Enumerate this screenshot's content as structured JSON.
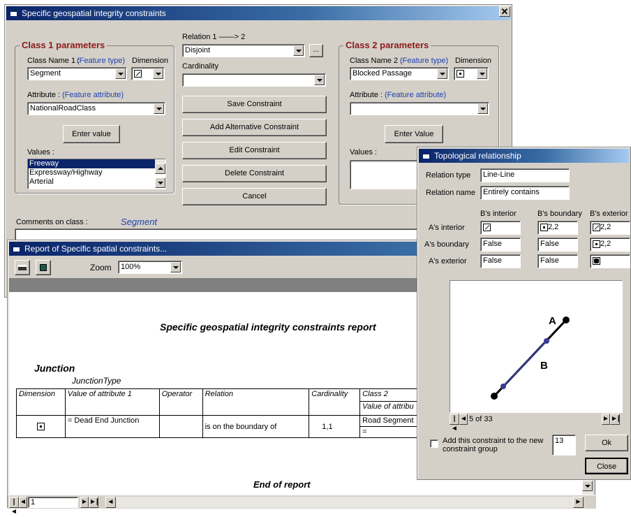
{
  "main_window": {
    "title": "Specific geospatial integrity constraints",
    "class1": {
      "group_title": "Class 1 parameters",
      "class_name_label": "Class Name 1 :",
      "feature_type_label": "(Feature type)",
      "dimension_label": "Dimension",
      "class_name_value": "Segment",
      "attribute_label": "Attribute :",
      "feature_attribute_label": "(Feature attribute)",
      "attribute_value": "NationalRoadClass",
      "enter_value_button": "Enter value",
      "values_label": "Values :",
      "values": [
        "Freeway",
        "Expressway/Highway",
        "Arterial"
      ],
      "selected_value_index": 0
    },
    "relation": {
      "label": "Relation 1 ——> 2",
      "value": "Disjoint",
      "more_button": "...",
      "cardinality_label": "Cardinality",
      "cardinality_value": ""
    },
    "buttons": {
      "save": "Save Constraint",
      "add_alt": "Add Alternative Constraint",
      "edit": "Edit Constraint",
      "delete": "Delete Constraint",
      "cancel": "Cancel"
    },
    "class2": {
      "group_title": "Class 2 parameters",
      "class_name_label": "Class Name 2 :",
      "feature_type_label": "(Feature type)",
      "dimension_label": "Dimension",
      "class_name_value": "Blocked Passage",
      "attribute_label": "Attribute :",
      "feature_attribute_label": "(Feature attribute)",
      "attribute_value": "",
      "enter_value_button": "Enter Value",
      "values_label": "Values :"
    },
    "comments_label": "Comments on class :",
    "comments_class": "Segment"
  },
  "report_window": {
    "title": "Report of Specific spatial constraints...",
    "zoom_label": "Zoom",
    "zoom_value": "100%",
    "report_title": "Specific geospatial integrity constraints  report",
    "section": "Junction",
    "subsection": "JunctionType",
    "table_headers": [
      "Dimension",
      "Value of attribute 1",
      "Operator",
      "Relation",
      "Cardinality",
      "Class 2"
    ],
    "class2_subheader": "Value of attribu",
    "row": {
      "value": "= Dead End Junction",
      "operator": "",
      "relation": "is on the boundary of",
      "cardinality": "1,1",
      "class2": "Road Segment",
      "class2_value": "="
    },
    "end_text": "End of report",
    "page_value": "1"
  },
  "topo_window": {
    "title": "Topological relationship",
    "relation_type_label": "Relation type",
    "relation_type_value": "Line-Line",
    "relation_name_label": "Relation name",
    "relation_name_value": "Entirely contains",
    "col_headers": [
      "B's interior",
      "B's boundary",
      "B's exterior"
    ],
    "row_headers": [
      "A's interior",
      "A's boundary",
      "A's exterior"
    ],
    "matrix": [
      [
        "",
        "2,2",
        "2,2"
      ],
      [
        "False",
        "False",
        "2,2"
      ],
      [
        "False",
        "False",
        ""
      ]
    ],
    "diagram_label_a": "A",
    "diagram_label_b": "B",
    "record_text": "5 of 33",
    "checkbox_label_1": "Add this constraint to the new",
    "checkbox_label_2": "constraint group",
    "group_number": "13",
    "ok_button": "Ok",
    "close_button": "Close"
  },
  "colors": {
    "title_bar": "#0a246a",
    "group_title": "#8b1a1a",
    "link_blue": "#2040b0",
    "diagram_line": "#000000",
    "diagram_point": "#3a3a9a"
  }
}
